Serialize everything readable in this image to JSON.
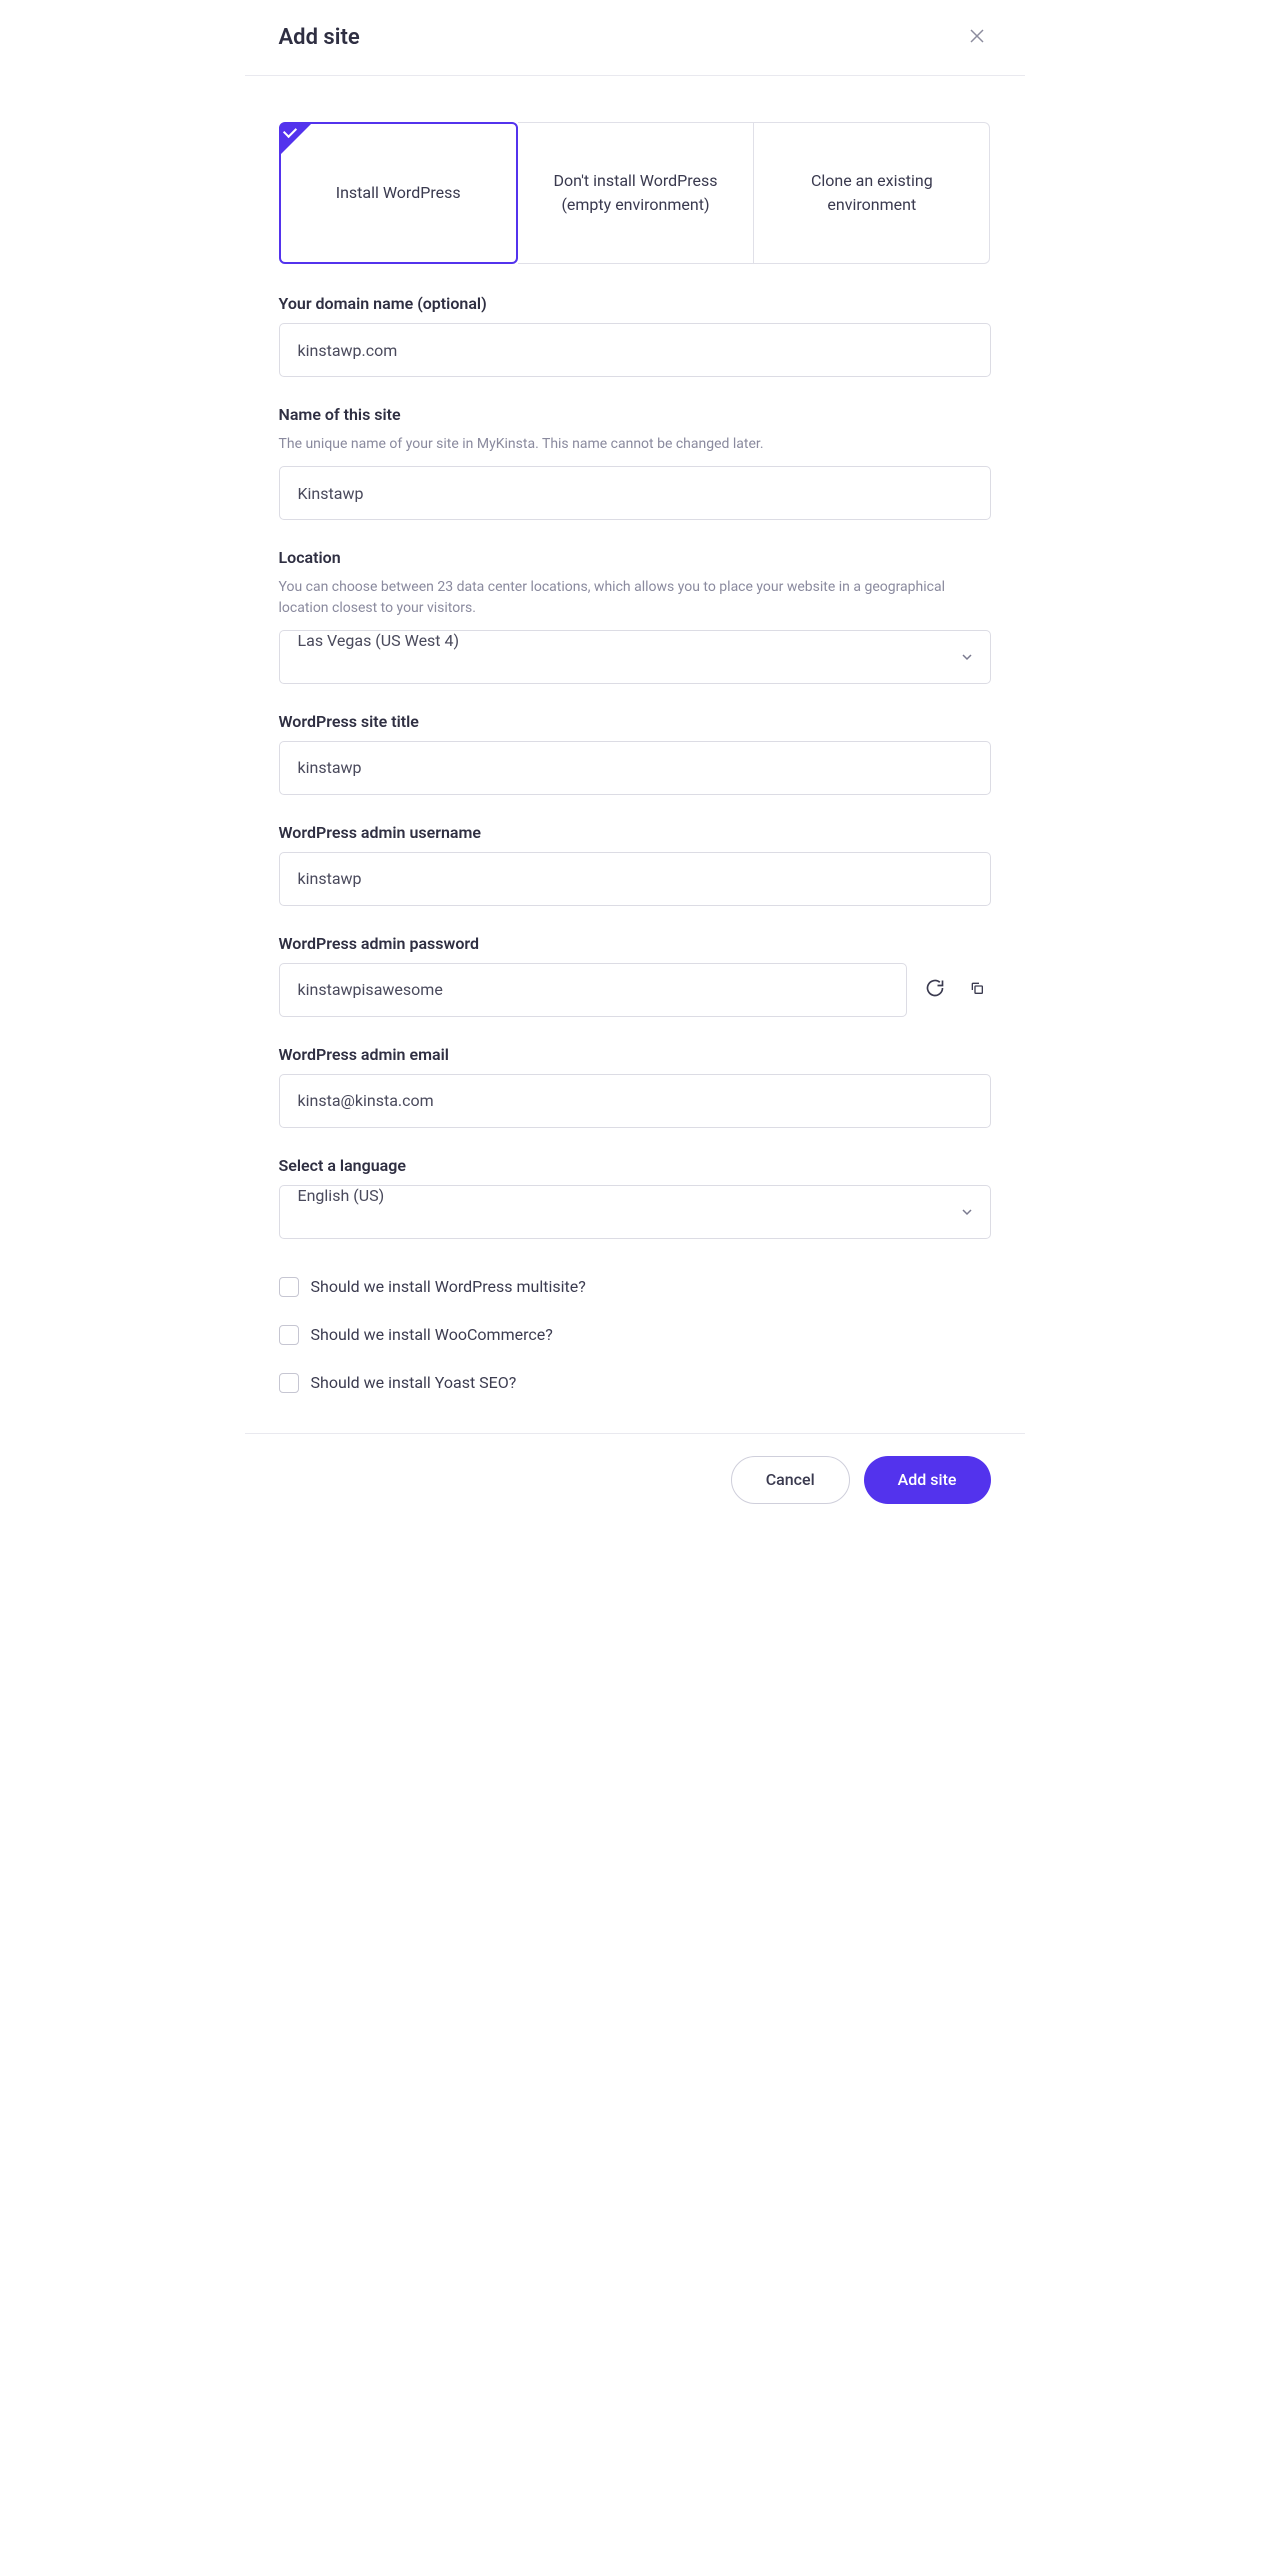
{
  "header": {
    "title": "Add site"
  },
  "options": [
    {
      "label": "Install WordPress",
      "selected": true
    },
    {
      "label": "Don't install WordPress (empty environment)",
      "selected": false
    },
    {
      "label": "Clone an existing environment",
      "selected": false
    }
  ],
  "fields": {
    "domain": {
      "label": "Your domain name (optional)",
      "value": "kinstawp.com"
    },
    "site_name": {
      "label": "Name of this site",
      "help": "The unique name of your site in MyKinsta. This name cannot be changed later.",
      "value": "Kinstawp"
    },
    "location": {
      "label": "Location",
      "help": "You can choose between 23 data center locations, which allows you to place your website in a geographical location closest to your visitors.",
      "value": "Las Vegas (US West 4)"
    },
    "wp_title": {
      "label": "WordPress site title",
      "value": "kinstawp"
    },
    "wp_admin_user": {
      "label": "WordPress admin username",
      "value": "kinstawp"
    },
    "wp_admin_pass": {
      "label": "WordPress admin password",
      "value": "kinstawpisawesome"
    },
    "wp_admin_email": {
      "label": "WordPress admin email",
      "value": "kinsta@kinsta.com"
    },
    "language": {
      "label": "Select a language",
      "value": "English (US)"
    }
  },
  "checkboxes": {
    "multisite": "Should we install WordPress multisite?",
    "woocommerce": "Should we install WooCommerce?",
    "yoast": "Should we install Yoast SEO?"
  },
  "footer": {
    "cancel": "Cancel",
    "submit": "Add site"
  }
}
